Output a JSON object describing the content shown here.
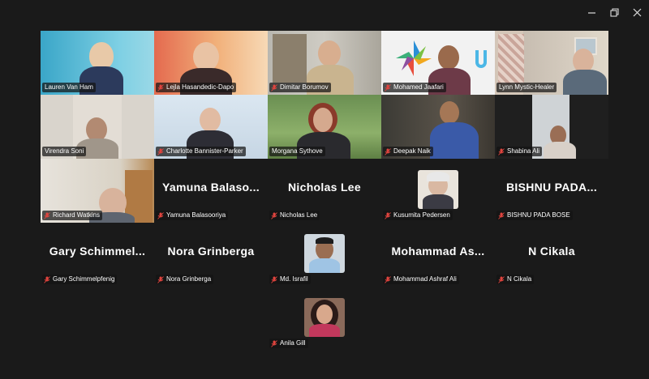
{
  "window": {
    "minimize_icon": "minimize-icon",
    "maximize_icon": "restore-icon",
    "close_icon": "close-icon"
  },
  "colors": {
    "background": "#1a1a1a",
    "active_speaker_border": "#39c46a",
    "muted_mic": "#e0443e"
  },
  "participants": [
    {
      "name": "Lauren Van Ham",
      "video": true,
      "muted": false
    },
    {
      "name": "Lejla Hasandedic-Dapo",
      "video": true,
      "muted": true
    },
    {
      "name": "Dimitar Borumov",
      "video": true,
      "muted": true
    },
    {
      "name": "Mohamed Jaafari",
      "video": true,
      "muted": true
    },
    {
      "name": "Lynn Mystic-Healer",
      "video": true,
      "muted": false,
      "active_speaker": true
    },
    {
      "name": "Virendra Soni",
      "video": true,
      "muted": false
    },
    {
      "name": "Charlotte Bannister-Parker",
      "video": true,
      "muted": true
    },
    {
      "name": "Morgana Sythove",
      "video": true,
      "muted": false
    },
    {
      "name": "Deepak Naik",
      "video": true,
      "muted": true
    },
    {
      "name": "Shabina Ali",
      "video": true,
      "muted": true
    },
    {
      "name": "Richard Watkins",
      "video": true,
      "muted": true
    },
    {
      "name": "Yamuna Balasooriya",
      "display": "Yamuna  Balaso...",
      "video": false,
      "muted": true
    },
    {
      "name": "Nicholas Lee",
      "display": "Nicholas Lee",
      "video": false,
      "muted": true
    },
    {
      "name": "Kusumita Pedersen",
      "video": false,
      "avatar": true,
      "muted": true
    },
    {
      "name": "BISHNU PADA BOSE",
      "display": "BISHNU  PADA...",
      "video": false,
      "muted": true
    },
    {
      "name": "Gary Schimmelpfenig",
      "display": "Gary  Schimmel...",
      "video": false,
      "muted": true
    },
    {
      "name": "Nora Grinberga",
      "display": "Nora Grinberga",
      "video": false,
      "muted": true
    },
    {
      "name": "Md. Israfil",
      "video": false,
      "avatar": true,
      "muted": true
    },
    {
      "name": "Mohammad Ashraf Ali",
      "display": "Mohammad  As...",
      "video": false,
      "muted": true
    },
    {
      "name": "N Cikala",
      "display": "N Cikala",
      "video": false,
      "muted": true
    },
    {
      "name": "Anila Gill",
      "video": false,
      "avatar": true,
      "muted": true
    }
  ]
}
